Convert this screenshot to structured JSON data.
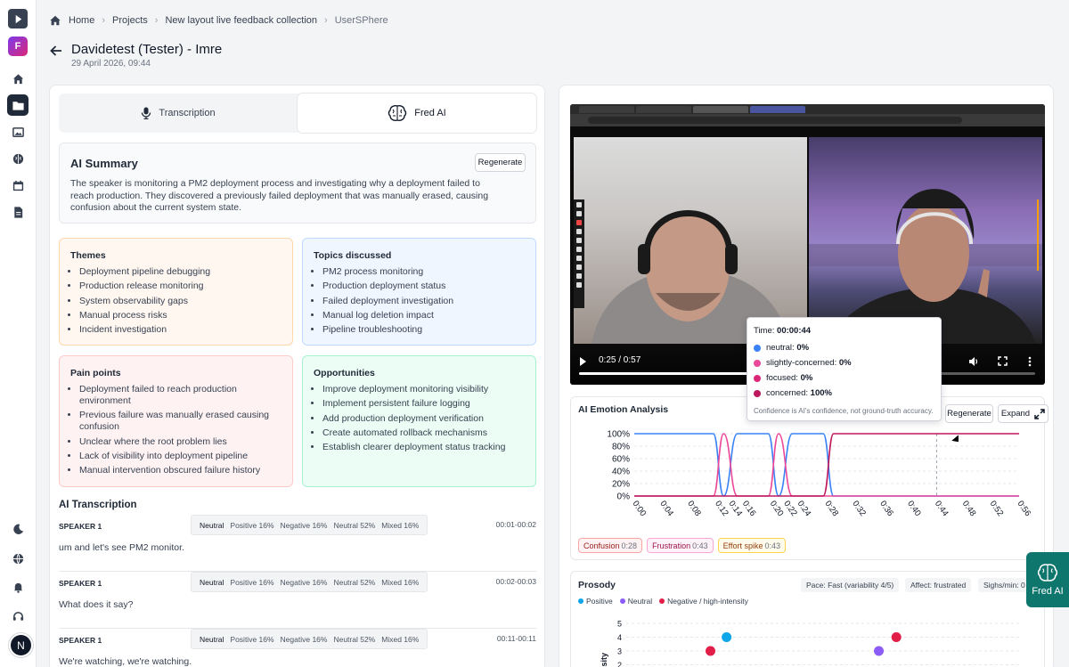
{
  "breadcrumb": {
    "home": "Home",
    "projects": "Projects",
    "project": "New layout live feedback collection",
    "current": "UserSPhere"
  },
  "org_initial": "F",
  "user_initial": "N",
  "header": {
    "title": "Davidetest (Tester) - Imre",
    "date": "29 April 2026, 09:44"
  },
  "tabs": {
    "transcription": "Transcription",
    "fred": "Fred AI"
  },
  "summary": {
    "title": "AI Summary",
    "regenerate": "Regenerate",
    "text": "The speaker is monitoring a PM2 deployment process and investigating why a deployment failed to reach production. They discovered a previously failed deployment that was manually erased, causing confusion about the current system state."
  },
  "themes": {
    "title": "Themes",
    "items": [
      "Deployment pipeline debugging",
      "Production release monitoring",
      "System observability gaps",
      "Manual process risks",
      "Incident investigation"
    ]
  },
  "topics": {
    "title": "Topics discussed",
    "items": [
      "PM2 process monitoring",
      "Production deployment status",
      "Failed deployment investigation",
      "Manual log deletion impact",
      "Pipeline troubleshooting"
    ]
  },
  "pains": {
    "title": "Pain points",
    "items": [
      "Deployment failed to reach production environment",
      "Previous failure was manually erased causing confusion",
      "Unclear where the root problem lies",
      "Lack of visibility into deployment pipeline",
      "Manual intervention obscured failure history"
    ]
  },
  "opps": {
    "title": "Opportunities",
    "items": [
      "Improve deployment monitoring visibility",
      "Implement persistent failure logging",
      "Add production deployment verification",
      "Create automated rollback mechanisms",
      "Establish clearer deployment status tracking"
    ]
  },
  "transcript": {
    "title": "AI Transcription",
    "segments": [
      {
        "speaker": "SPEAKER 1",
        "time": "00:01-00:02",
        "text": "um and let's see PM2 monitor.",
        "chips": [
          "Neutral",
          "Positive 16%",
          "Negative 16%",
          "Neutral 52%",
          "Mixed 16%"
        ]
      },
      {
        "speaker": "SPEAKER 1",
        "time": "00:02-00:03",
        "text": "What does it say?",
        "chips": [
          "Neutral",
          "Positive 16%",
          "Negative 16%",
          "Neutral 52%",
          "Mixed 16%"
        ]
      },
      {
        "speaker": "SPEAKER 1",
        "time": "00:11-00:11",
        "text": "We're watching, we're watching.",
        "chips": [
          "Neutral",
          "Positive 16%",
          "Negative 16%",
          "Neutral 52%",
          "Mixed 16%"
        ]
      }
    ]
  },
  "video": {
    "time": "0:25 / 0:57",
    "progress": 0.44
  },
  "tooltip": {
    "time_label": "Time:",
    "time": "00:00:44",
    "rows": [
      {
        "label": "neutral:",
        "value": "0%",
        "color": "#3b82f6"
      },
      {
        "label": "slightly-concerned:",
        "value": "0%",
        "color": "#ec4899"
      },
      {
        "label": "focused:",
        "value": "0%",
        "color": "#db2777"
      },
      {
        "label": "concerned:",
        "value": "100%",
        "color": "#be185d"
      }
    ],
    "note": "Confidence is AI's confidence, not ground-truth accuracy."
  },
  "emotion": {
    "title": "AI Emotion Analysis",
    "regenerate": "Regenerate",
    "expand": "Expand"
  },
  "chart_data": {
    "type": "line",
    "x": [
      "0:00",
      "0:04",
      "0:08",
      "0:12",
      "0:14",
      "0:16",
      "0:20",
      "0:22",
      "0:24",
      "0:28",
      "0:32",
      "0:36",
      "0:40",
      "0:44",
      "0:48",
      "0:52",
      "0:56"
    ],
    "yticks": [
      "100%",
      "80%",
      "60%",
      "40%",
      "20%",
      "0%"
    ],
    "ylim": [
      0,
      100
    ],
    "series": [
      {
        "name": "neutral",
        "color": "#3b82f6",
        "points": [
          [
            0,
            100
          ],
          [
            11.5,
            100
          ],
          [
            13,
            0
          ],
          [
            15,
            100
          ],
          [
            19.5,
            100
          ],
          [
            21,
            0
          ],
          [
            23,
            100
          ],
          [
            27.5,
            100
          ],
          [
            29,
            0
          ],
          [
            56,
            0
          ]
        ]
      },
      {
        "name": "slightly-concerned",
        "color": "#ec4899",
        "points": [
          [
            0,
            0
          ],
          [
            11.5,
            0
          ],
          [
            13,
            100
          ],
          [
            15,
            0
          ],
          [
            19.5,
            0
          ],
          [
            21,
            100
          ],
          [
            23,
            0
          ],
          [
            56,
            0
          ]
        ]
      },
      {
        "name": "concerned",
        "color": "#be185d",
        "points": [
          [
            0,
            0
          ],
          [
            27.5,
            0
          ],
          [
            29,
            100
          ],
          [
            56,
            100
          ]
        ]
      }
    ],
    "cursor_x": 44
  },
  "markers": [
    {
      "label": "Confusion",
      "time": "0:28"
    },
    {
      "label": "Frustration",
      "time": "0:43"
    },
    {
      "label": "Effort spike",
      "time": "0:43"
    }
  ],
  "prosody": {
    "title": "Prosody",
    "chips": [
      "Pace: Fast (variability 4/5)",
      "Affect: frustrated",
      "Sighs/min: 0"
    ],
    "legend": [
      {
        "label": "Positive",
        "color": "#0ea5e9"
      },
      {
        "label": "Neutral",
        "color": "#8b5cf6"
      },
      {
        "label": "Negative / high-intensity",
        "color": "#e11d48"
      }
    ],
    "ylabel": "Intensity",
    "yticks": [
      "5",
      "4",
      "3",
      "2"
    ],
    "points": [
      {
        "t": 12,
        "v": 3,
        "color": "#e11d48"
      },
      {
        "t": 14.3,
        "v": 4,
        "color": "#0ea5e9"
      },
      {
        "t": 36,
        "v": 3,
        "color": "#8b5cf6"
      },
      {
        "t": 38.5,
        "v": 4,
        "color": "#e11d48"
      }
    ]
  },
  "fred_button": "Fred AI"
}
